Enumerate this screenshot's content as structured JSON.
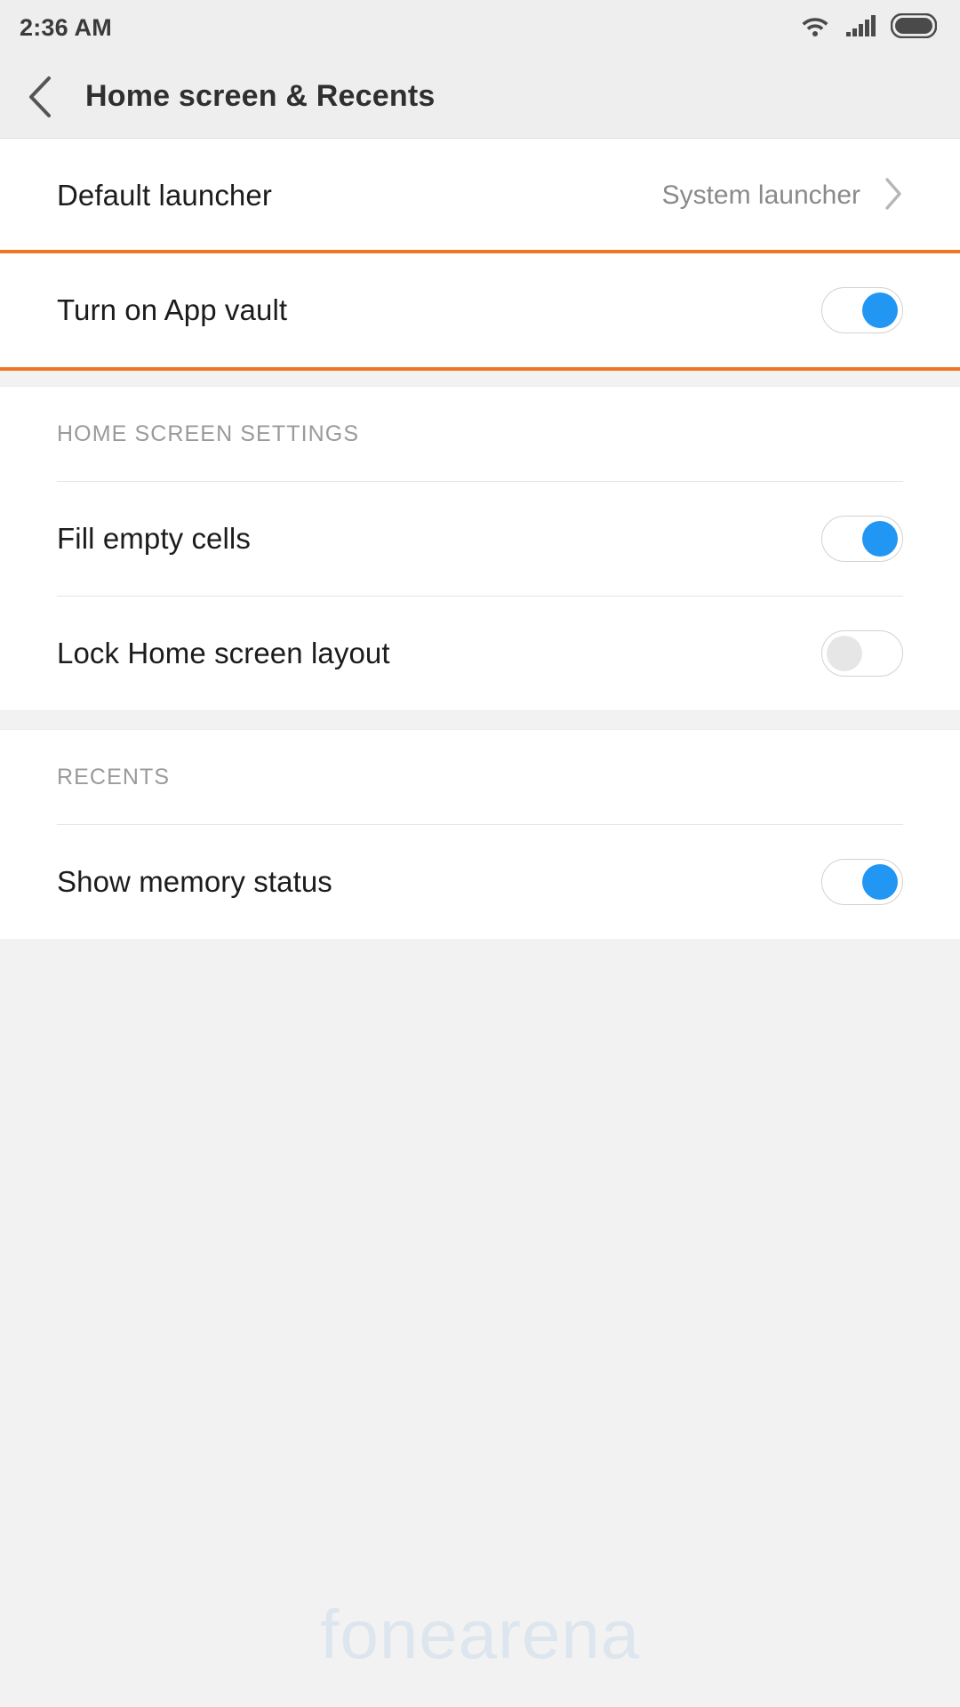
{
  "status_bar": {
    "time": "2:36 AM",
    "icons": [
      "wifi-icon",
      "cellular-signal-icon",
      "battery-icon"
    ]
  },
  "header": {
    "title": "Home screen & Recents",
    "back_icon": "chevron-left-icon"
  },
  "colors": {
    "accent_blue": "#2196f3",
    "highlight_orange": "#ee7723",
    "background": "#f2f2f2",
    "card": "#ffffff",
    "label_text": "#1c1c1c",
    "value_text": "#8a8a8a",
    "section_text": "#9a9a9a"
  },
  "sections": [
    {
      "id": "top",
      "header": null,
      "rows": [
        {
          "id": "default-launcher",
          "label": "Default launcher",
          "value": "System launcher",
          "control": "chevron",
          "highlighted": false
        },
        {
          "id": "turn-on-app-vault",
          "label": "Turn on App vault",
          "value": null,
          "control": "toggle",
          "toggle_state": "on",
          "highlighted": true
        }
      ]
    },
    {
      "id": "home-screen-settings",
      "header": "HOME SCREEN SETTINGS",
      "rows": [
        {
          "id": "fill-empty-cells",
          "label": "Fill empty cells",
          "value": null,
          "control": "toggle",
          "toggle_state": "on",
          "highlighted": false
        },
        {
          "id": "lock-home-screen-layout",
          "label": "Lock Home screen layout",
          "value": null,
          "control": "toggle",
          "toggle_state": "off",
          "highlighted": false
        }
      ]
    },
    {
      "id": "recents",
      "header": "RECENTS",
      "rows": [
        {
          "id": "show-memory-status",
          "label": "Show memory status",
          "value": null,
          "control": "toggle",
          "toggle_state": "on",
          "highlighted": false
        }
      ]
    }
  ],
  "watermark": "fonearena"
}
